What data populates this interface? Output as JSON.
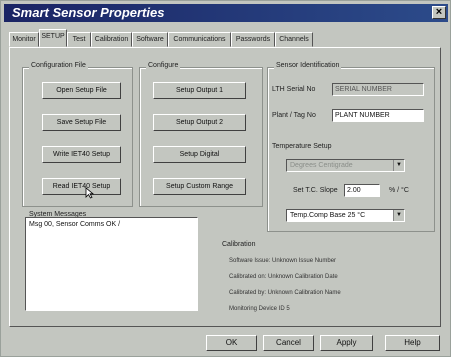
{
  "window": {
    "title": "Smart Sensor Properties",
    "close_glyph": "×"
  },
  "tabs": [
    "Monitor",
    "SETUP",
    "Test",
    "Calibration",
    "Software",
    "Communications",
    "Passwords",
    "Channels"
  ],
  "active_tab": "SETUP",
  "configuration_file": {
    "legend": "Configuration File",
    "buttons": [
      "Open Setup File",
      "Save Setup File",
      "Write IET40 Setup",
      "Read IET40 Setup"
    ]
  },
  "configure": {
    "legend": "Configure",
    "buttons": [
      "Setup Output 1",
      "Setup Output 2",
      "Setup Digital",
      "Setup Custom Range"
    ]
  },
  "sensor_identification": {
    "legend": "Sensor Identification",
    "serial_label": "LTH Serial No",
    "serial_value": "SERIAL NUMBER",
    "plant_label": "Plant / Tag No",
    "plant_value": "PLANT NUMBER"
  },
  "temperature_setup": {
    "label": "Temperature Setup",
    "mode_value": "Degrees Centigrade",
    "slope_label": "Set T.C. Slope",
    "slope_value": "2.00",
    "slope_unit": "% / °C",
    "comp_value": "Temp.Comp Base 25 °C"
  },
  "system_messages": {
    "legend": "System Messages",
    "message": "Msg 00, Sensor Comms OK  /"
  },
  "calibration": {
    "label": "Calibration",
    "lines": [
      "Software Issue: Unknown Issue Number",
      "Calibrated on: Unknown Calibration Date",
      "Calibrated by: Unknown Calibration Name",
      "Monitoring Device ID 5"
    ]
  },
  "footer": {
    "ok": "OK",
    "cancel": "Cancel",
    "apply": "Apply",
    "help": "Help"
  }
}
